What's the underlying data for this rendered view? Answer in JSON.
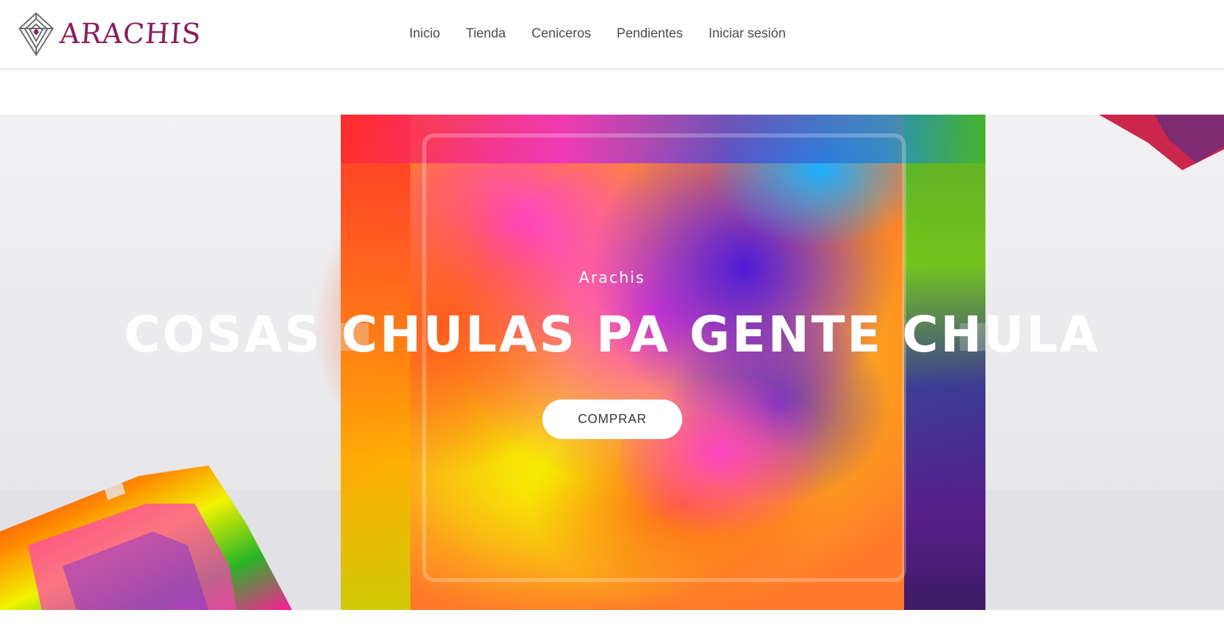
{
  "header": {
    "logo_text": "ARACHIS",
    "nav": [
      {
        "label": "Inicio"
      },
      {
        "label": "Tienda"
      },
      {
        "label": "Ceniceros"
      },
      {
        "label": "Pendientes"
      },
      {
        "label": "Iniciar sesión"
      }
    ]
  },
  "hero": {
    "overline": "Arachis",
    "title": "COSAS CHULAS PA GENTE CHULA",
    "button_label": "COMPRAR",
    "background_image": "colorful-resin-ashtray-photo"
  },
  "colors": {
    "brand": "#8e1b5a",
    "nav_text": "#4b4b4b",
    "hero_text": "#ffffff",
    "button_bg": "#ffffff"
  }
}
